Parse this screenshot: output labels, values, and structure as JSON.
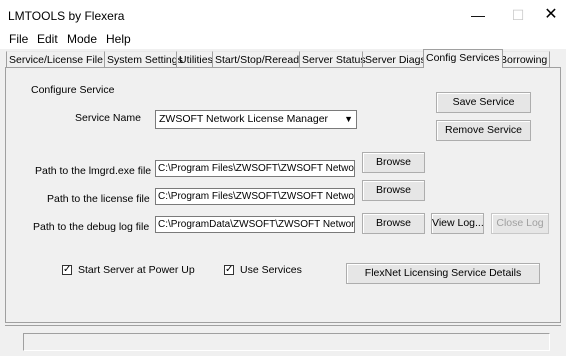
{
  "window": {
    "title": "LMTOOLS by Flexera",
    "min_glyph": "—",
    "max_glyph": "☐",
    "close_glyph": "✕"
  },
  "menu": [
    "File",
    "Edit",
    "Mode",
    "Help"
  ],
  "tabs": [
    "Service/License File",
    "System Settings",
    "Utilities",
    "Start/Stop/Reread",
    "Server Status",
    "Server Diags",
    "Config Services",
    "Borrowing"
  ],
  "active_tab": "Config Services",
  "config": {
    "section_label": "Configure Service",
    "service_name_label": "Service Name",
    "service_name_value": "ZWSOFT Network License Manager",
    "save_button": "Save Service",
    "remove_button": "Remove Service",
    "lmgrd_label": "Path to the lmgrd.exe file",
    "lmgrd_value": "C:\\Program Files\\ZWSOFT\\ZWSOFT Network L",
    "license_label": "Path to the license file",
    "license_value": "C:\\Program Files\\ZWSOFT\\ZWSOFT Network L",
    "debug_label": "Path to the debug log file",
    "debug_value": "C:\\ProgramData\\ZWSOFT\\ZWSOFT Network L",
    "browse_label": "Browse",
    "view_log_button": "View Log...",
    "close_log_button": "Close Log",
    "start_at_power_up_label": "Start Server at Power Up",
    "start_at_power_up_checked": true,
    "use_services_label": "Use Services",
    "use_services_checked": true,
    "flexnet_button": "FlexNet Licensing Service Details"
  },
  "status": {
    "text": ""
  }
}
